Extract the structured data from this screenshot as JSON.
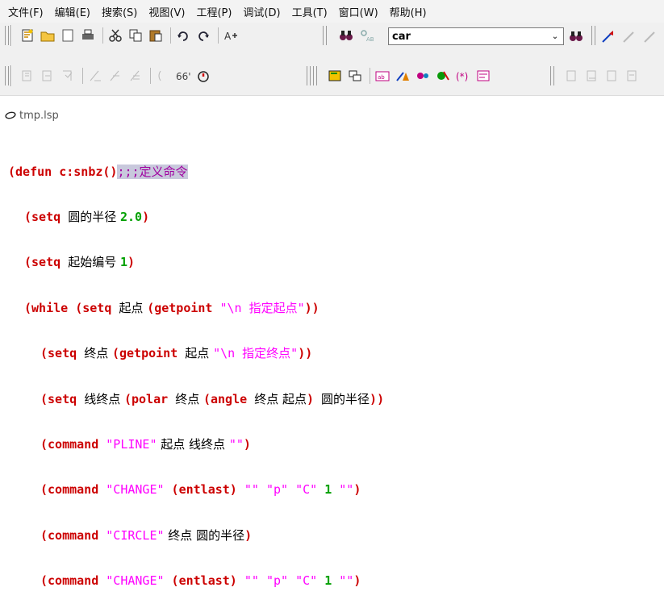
{
  "menu": [
    "文件(F)",
    "编辑(E)",
    "搜索(S)",
    "视图(V)",
    "工程(P)",
    "调试(D)",
    "工具(T)",
    "窗口(W)",
    "帮助(H)"
  ],
  "toolbar": {
    "search_value": "car"
  },
  "document": {
    "tab_label": "tmp.lsp"
  },
  "code": [
    "(defun c:snbz();;;定义命令",
    "(setq 圆的半径 2.0)",
    "(setq 起始编号 1)",
    "(while (setq 起点 (getpoint \"\\n 指定起点\"))",
    "(setq 终点 (getpoint 起点 \"\\n 指定终点\"))",
    "(setq 线终点 (polar 终点 (angle 终点 起点) 圆的半径))",
    "(command \"PLINE\" 起点 线终点 \"\")",
    "(command \"CHANGE\" (entlast) \"\" \"p\" \"C\" 1 \"\")",
    "(command \"CIRCLE\" 终点 圆的半径)",
    "(command \"CHANGE\" (entlast) \"\" \"p\" \"C\" 1 \"\")"
  ]
}
